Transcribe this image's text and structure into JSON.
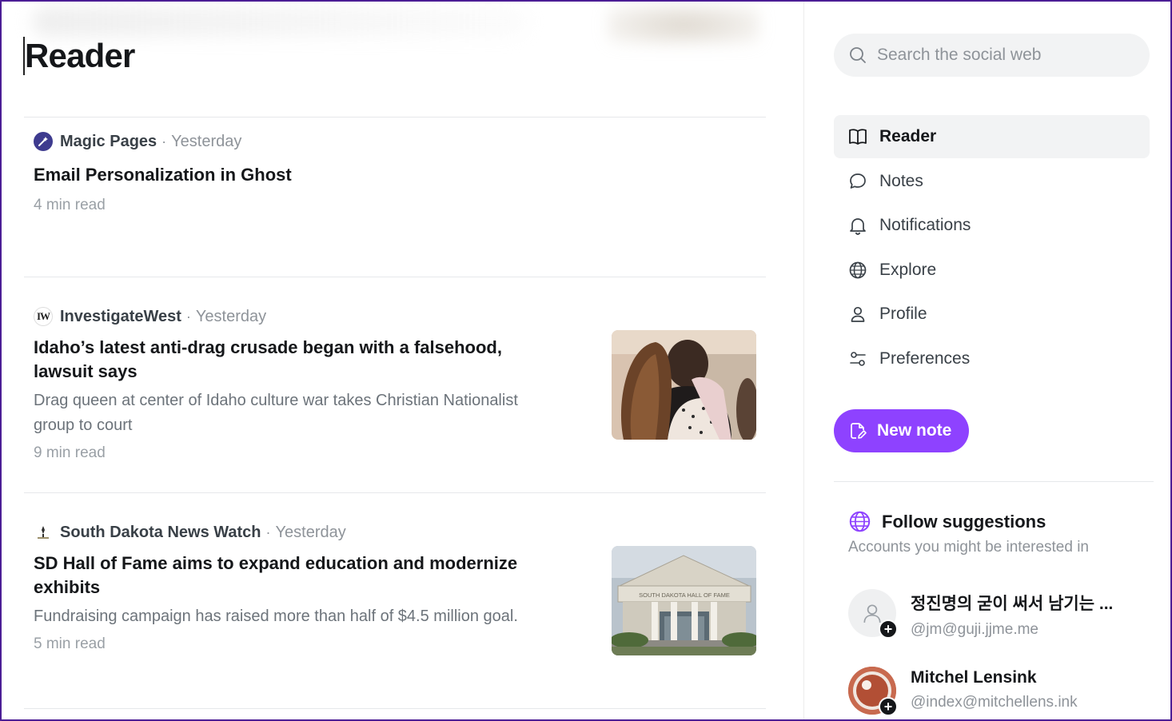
{
  "page": {
    "title": "Reader"
  },
  "posts": [
    {
      "publication": "Magic Pages",
      "time": "Yesterday",
      "title": "Email Personalization in Ghost",
      "excerpt": "",
      "read_time": "4 min read",
      "icon": "magic-wand-icon"
    },
    {
      "publication": "InvestigateWest",
      "time": "Yesterday",
      "title": "Idaho’s latest anti-drag crusade began with a falsehood, lawsuit says",
      "excerpt": "Drag queen at center of Idaho culture war takes Christian Nationalist group to court",
      "read_time": "9 min read",
      "icon_text": "IW"
    },
    {
      "publication": "South Dakota News Watch",
      "time": "Yesterday",
      "title": "SD Hall of Fame aims to expand education and modernize exhibits",
      "excerpt": "Fundraising campaign has raised more than half of $4.5 million goal.",
      "read_time": "5 min read",
      "icon": "sd-logo-icon",
      "image_sign": "SOUTH DAKOTA HALL OF FAME"
    }
  ],
  "search": {
    "placeholder": "Search the social web"
  },
  "nav": {
    "items": [
      {
        "label": "Reader",
        "icon": "book-open-icon",
        "active": true
      },
      {
        "label": "Notes",
        "icon": "speech-bubble-icon"
      },
      {
        "label": "Notifications",
        "icon": "bell-icon"
      },
      {
        "label": "Explore",
        "icon": "globe-icon"
      },
      {
        "label": "Profile",
        "icon": "user-icon"
      },
      {
        "label": "Preferences",
        "icon": "sliders-icon"
      }
    ]
  },
  "new_note": {
    "label": "New note",
    "icon": "edit-file-icon"
  },
  "follow": {
    "title": "Follow suggestions",
    "subtitle": "Accounts you might be interested in",
    "accounts": [
      {
        "name": "정진명의 굳이 써서 남기는 ...",
        "handle": "@jm@guji.jjme.me"
      },
      {
        "name": "Mitchel Lensink",
        "handle": "@index@mitchellens.ink"
      }
    ]
  },
  "colors": {
    "accent": "#8e42ff",
    "text": "#15171a",
    "muted": "#8e9399",
    "frame": "#4b1d95"
  }
}
